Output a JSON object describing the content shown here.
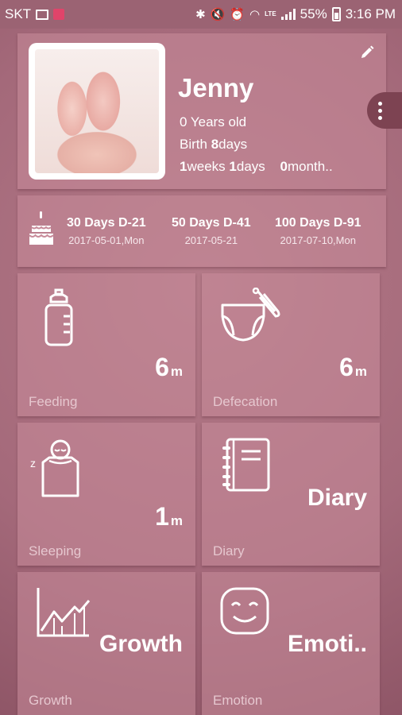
{
  "statusbar": {
    "carrier": "SKT",
    "lte": "LTE",
    "battery": "55%",
    "time": "3:16 PM"
  },
  "profile": {
    "name": "Jenny",
    "age": "0 Years old",
    "birth_prefix": "Birth ",
    "birth_days": "8",
    "birth_suffix": "days",
    "weeks": "1",
    "weeks_label": "weeks ",
    "days": "1",
    "days_label": "days",
    "months": "0",
    "months_label": "month.."
  },
  "ddays": [
    {
      "title": "30 Days D-21",
      "date": "2017-05-01,Mon"
    },
    {
      "title": "50 Days D-41",
      "date": "2017-05-21"
    },
    {
      "title": "100 Days D-91",
      "date": "2017-07-10,Mon"
    }
  ],
  "tiles": {
    "feeding": {
      "value": "6",
      "unit": "m",
      "label": "Feeding"
    },
    "defecation": {
      "value": "6",
      "unit": "m",
      "label": "Defecation"
    },
    "sleeping": {
      "value": "1",
      "unit": "m",
      "label": "Sleeping",
      "z": "z"
    },
    "diary": {
      "value": "Diary",
      "label": "Diary"
    },
    "growth": {
      "value": "Growth",
      "label": "Growth"
    },
    "emotion": {
      "value": "Emoti..",
      "label": "Emotion"
    }
  },
  "icons": {
    "photo": "baby-feet-photo",
    "edit": "pencil-icon",
    "menu": "more-vert-icon",
    "cake": "birthday-cake-icon",
    "feeding": "baby-bottle-icon",
    "defecation": "diaper-icon",
    "sleeping": "sleeping-baby-icon",
    "diary": "notebook-icon",
    "growth": "growth-chart-icon",
    "emotion": "smiley-face-icon"
  },
  "colors": {
    "background": "#a96e7c",
    "card": "#c88c9b",
    "accent_dark": "#7d4352",
    "label": "#e6c7cf"
  }
}
